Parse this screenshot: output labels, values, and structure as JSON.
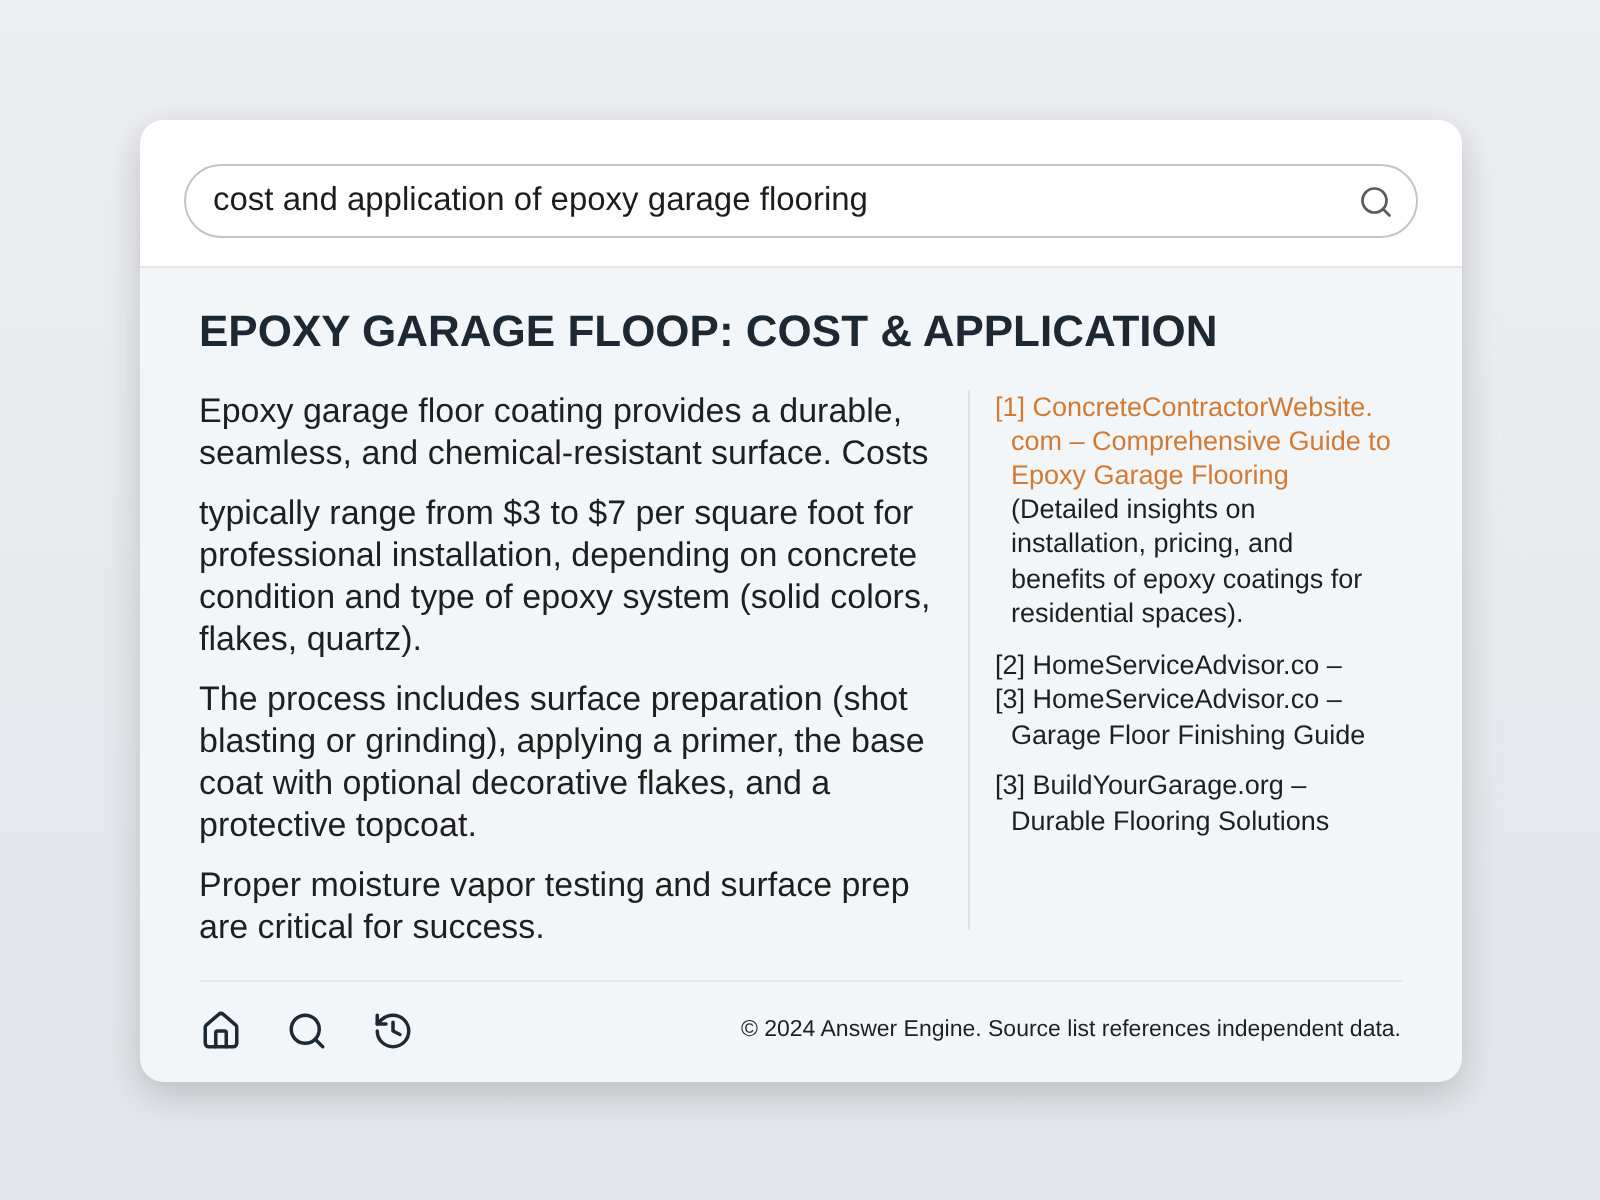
{
  "search": {
    "value": "cost and application of epoxy garage flooring"
  },
  "answer": {
    "title": "EPOXY GARAGE FLOOP: COST & APPLICATION",
    "paragraphs": [
      "Epoxy garage floor coating provides a durable, seamless, and chemical-resistant surface. Costs",
      "typically range from $3 to $7 per square foot for professional installation, depending on concrete condition and type of epoxy system (solid colors, flakes, quartz).",
      "The process includes surface preparation (shot blasting or grinding), applying a primer, the base coat with optional decorative flakes, and a protective topcoat.",
      "Proper moisture vapor testing and surface prep are critical for success."
    ]
  },
  "sources": [
    {
      "entries": [
        {
          "kind": "link",
          "text": "[1] ConcreteContractorWebsite.com – Comprehensive Guide to Epoxy Garage Flooring",
          "note": "(Detailed insights on installation, pricing, and benefits of epoxy coatings for residential spaces)."
        }
      ]
    },
    {
      "entries": [
        {
          "kind": "plain",
          "text": "[2] HomeServiceAdvisor.co –"
        },
        {
          "kind": "plain",
          "text": "[3] HomeServiceAdvisor.co – Garage Floor Finishing Guide"
        }
      ]
    },
    {
      "entries": [
        {
          "kind": "plain",
          "text": "[3] BuildYourGarage.org – Durable Flooring Solutions"
        }
      ]
    }
  ],
  "footer": {
    "nav": [
      {
        "kind": "home"
      },
      {
        "kind": "search"
      },
      {
        "kind": "history"
      }
    ],
    "copyright": "© 2024 Answer Engine. Source list references independent data."
  }
}
